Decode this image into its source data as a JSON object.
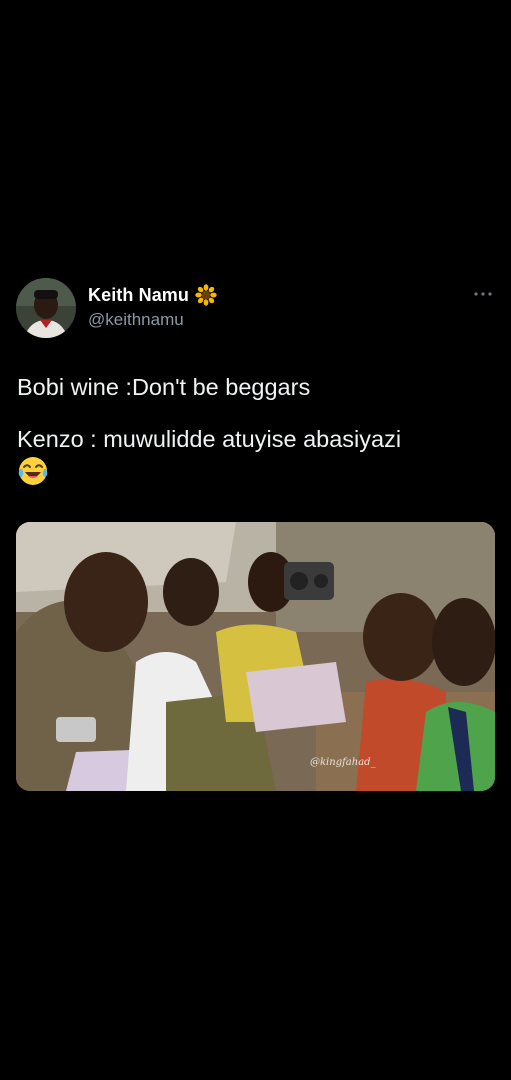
{
  "tweet": {
    "author": {
      "display_name": "Keith Namu",
      "name_emoji": "🌻",
      "handle": "@keithnamu",
      "avatar_icon": "avatar-portrait"
    },
    "more_icon": "more-horizontal-icon",
    "text_lines": [
      "Bobi wine :Don't be beggars",
      "Kenzo : muwulidde atuyise abasiyazi"
    ],
    "trailing_emoji": "😂",
    "media": {
      "description_icon": "photo",
      "watermark": "@kingfahad_"
    }
  },
  "colors": {
    "background": "#000000",
    "primary_text": "#e7e9ea",
    "secondary_text": "#8b98a5"
  }
}
